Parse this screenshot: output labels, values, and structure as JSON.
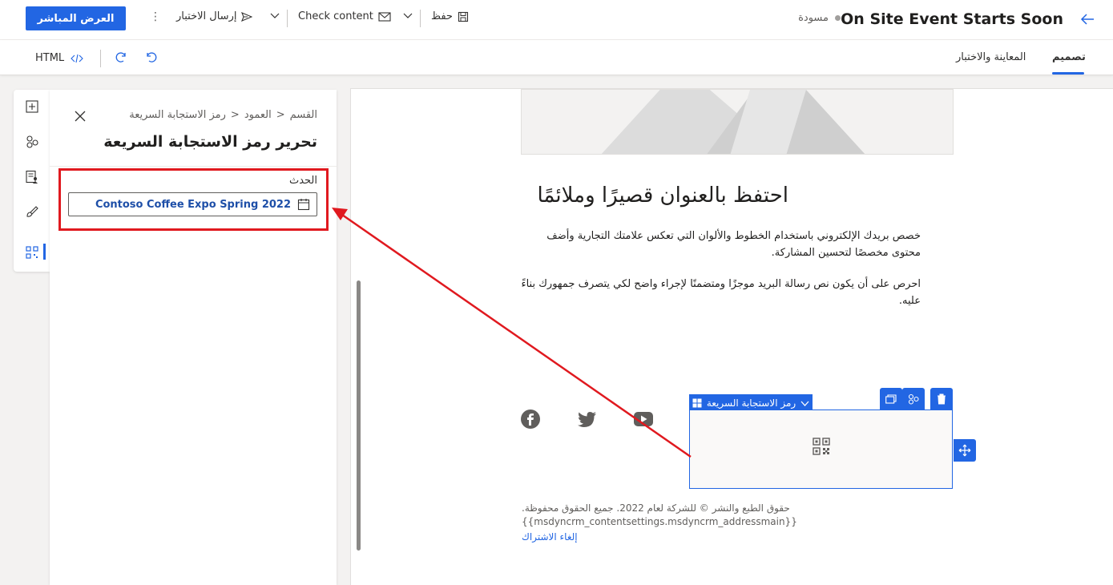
{
  "header": {
    "title": "On Site Event Starts Soon",
    "status": "مسودة",
    "go_live": "العرض المباشر",
    "save": "حفظ",
    "check_content": "Check content",
    "send_test": "إرسال الاختبار"
  },
  "tabs": {
    "design": "تصميم",
    "preview": "المعاينة والاختبار",
    "html": "HTML"
  },
  "panel": {
    "breadcrumb": [
      "القسم",
      "العمود",
      "رمز الاستجابة السريعة"
    ],
    "title": "تحرير رمز الاستجابة السريعة",
    "field_label": "الحدث",
    "field_value": "Contoso Coffee Expo Spring 2022"
  },
  "canvas": {
    "heading": "احتفظ بالعنوان قصيرًا وملائمًا",
    "para1_line1": "خصص بريدك الإلكتروني باستخدام الخطوط والألوان التي تعكس علامتك التجارية وأضف",
    "para1_line2": "محتوى مخصصًا لتحسين المشاركة.",
    "para2_line1": "احرص على أن يكون نص رسالة البريد موجزًا ومتضمنًا لإجراء واضح لكي يتصرف جمهورك بناءً",
    "para2_line2": "عليه.",
    "qr_label": "رمز الاستجابة السريعة",
    "footer_line1": "حقوق الطبع والنشر © للشركة لعام 2022. جميع الحقوق محفوظة.",
    "footer_line2": "{{msdyncrm_contentsettings.msdyncrm_addressmain}}",
    "unsubscribe": "إلغاء الاشتراك"
  },
  "colors": {
    "accent": "#2266e3",
    "highlight": "#e0191f"
  }
}
